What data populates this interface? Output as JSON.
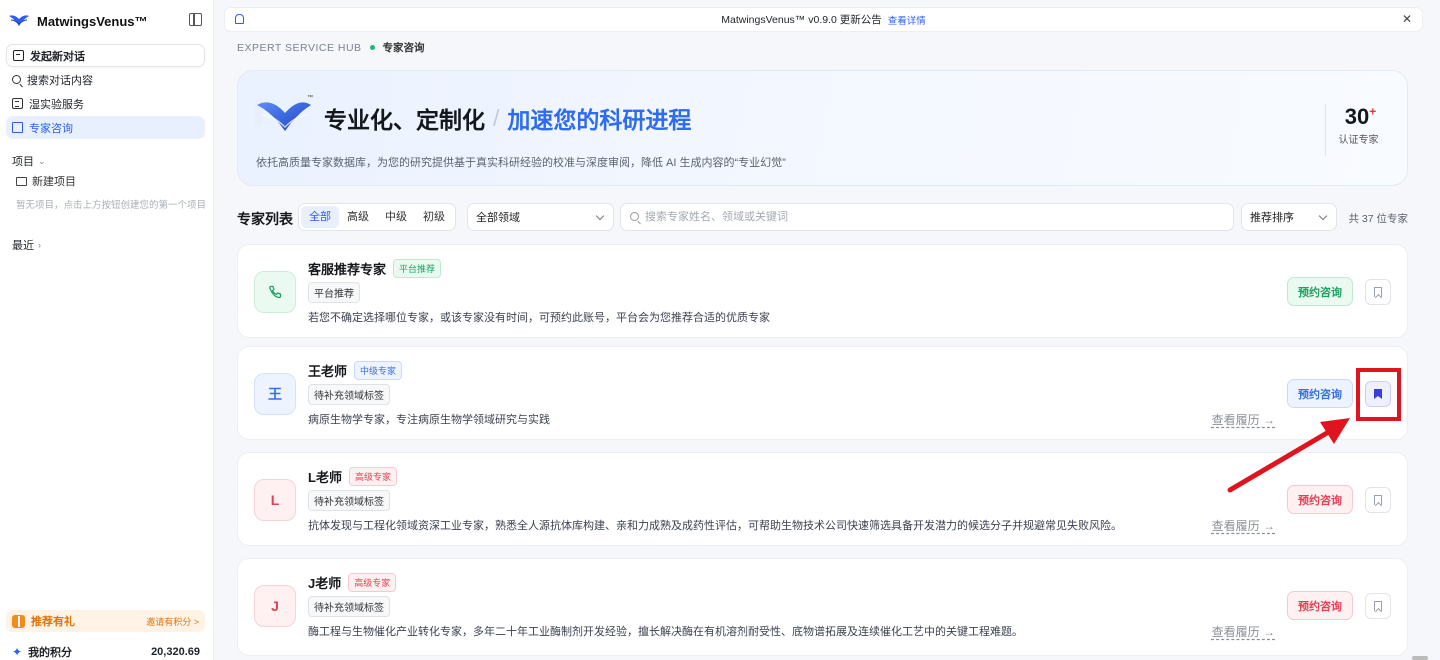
{
  "sidebar": {
    "brand": "MatwingsVenus™",
    "nav": [
      {
        "label": "发起新对话"
      },
      {
        "label": "搜索对话内容"
      },
      {
        "label": "湿实验服务"
      },
      {
        "label": "专家咨询"
      }
    ],
    "projects_label": "项目",
    "new_project": "新建项目",
    "empty_hint": "暂无项目，点击上方按钮创建您的第一个项目",
    "recent_label": "最近",
    "referral_label": "推荐有礼",
    "referral_link": "邀请有积分 >",
    "points_label": "我的积分",
    "points_value": "20,320.69"
  },
  "announcement": {
    "text": "MatwingsVenus™ v0.9.0 更新公告",
    "link": "查看详情"
  },
  "breadcrumb": {
    "hub": "EXPERT SERVICE HUB",
    "current": "专家咨询"
  },
  "hero": {
    "title_a": "专业化、定制化",
    "title_b": "加速您的科研进程",
    "description": "依托高质量专家数据库，为您的研究提供基于真实科研经验的校准与深度审阅，降低 AI 生成内容的“专业幻觉”",
    "stat_value": "30",
    "stat_suffix": "+",
    "stat_label": "认证专家"
  },
  "toolbar": {
    "title": "专家列表",
    "levels": [
      "全部",
      "高级",
      "中级",
      "初级"
    ],
    "field_select": "全部领域",
    "search_placeholder": "搜索专家姓名、领域或关键词",
    "sort_select": "推荐排序",
    "count": "共 37 位专家"
  },
  "experts": [
    {
      "avatar": "",
      "name": "客服推荐专家",
      "badge": "平台推荐",
      "tag": "平台推荐",
      "description": "若您不确定选择哪位专家，或该专家没有时间，可预约此账号，平台会为您推荐合适的优质专家",
      "book_label": "预约咨询",
      "history": ""
    },
    {
      "avatar": "王",
      "name": "王老师",
      "badge": "中级专家",
      "tag": "待补充领域标签",
      "description": "病原生物学专家，专注病原生物学领域研究与实践",
      "book_label": "预约咨询",
      "history": "查看履历 →"
    },
    {
      "avatar": "L",
      "name": "L老师",
      "badge": "高级专家",
      "tag": "待补充领域标签",
      "description": "抗体发现与工程化领域资深工业专家，熟悉全人源抗体库构建、亲和力成熟及成药性评估，可帮助生物技术公司快速筛选具备开发潜力的候选分子并规避常见失败风险。",
      "book_label": "预约咨询",
      "history": "查看履历 →"
    },
    {
      "avatar": "J",
      "name": "J老师",
      "badge": "高级专家",
      "tag": "待补充领域标签",
      "description": "酶工程与生物催化产业转化专家，多年二十年工业酶制剂开发经验，擅长解决酶在有机溶剂耐受性、底物谱拓展及连续催化工艺中的关键工程难题。",
      "book_label": "预约咨询",
      "history": "查看履历 →"
    }
  ],
  "colors": {
    "accent": "#2d5cf6",
    "annotation": "#e0141e"
  }
}
